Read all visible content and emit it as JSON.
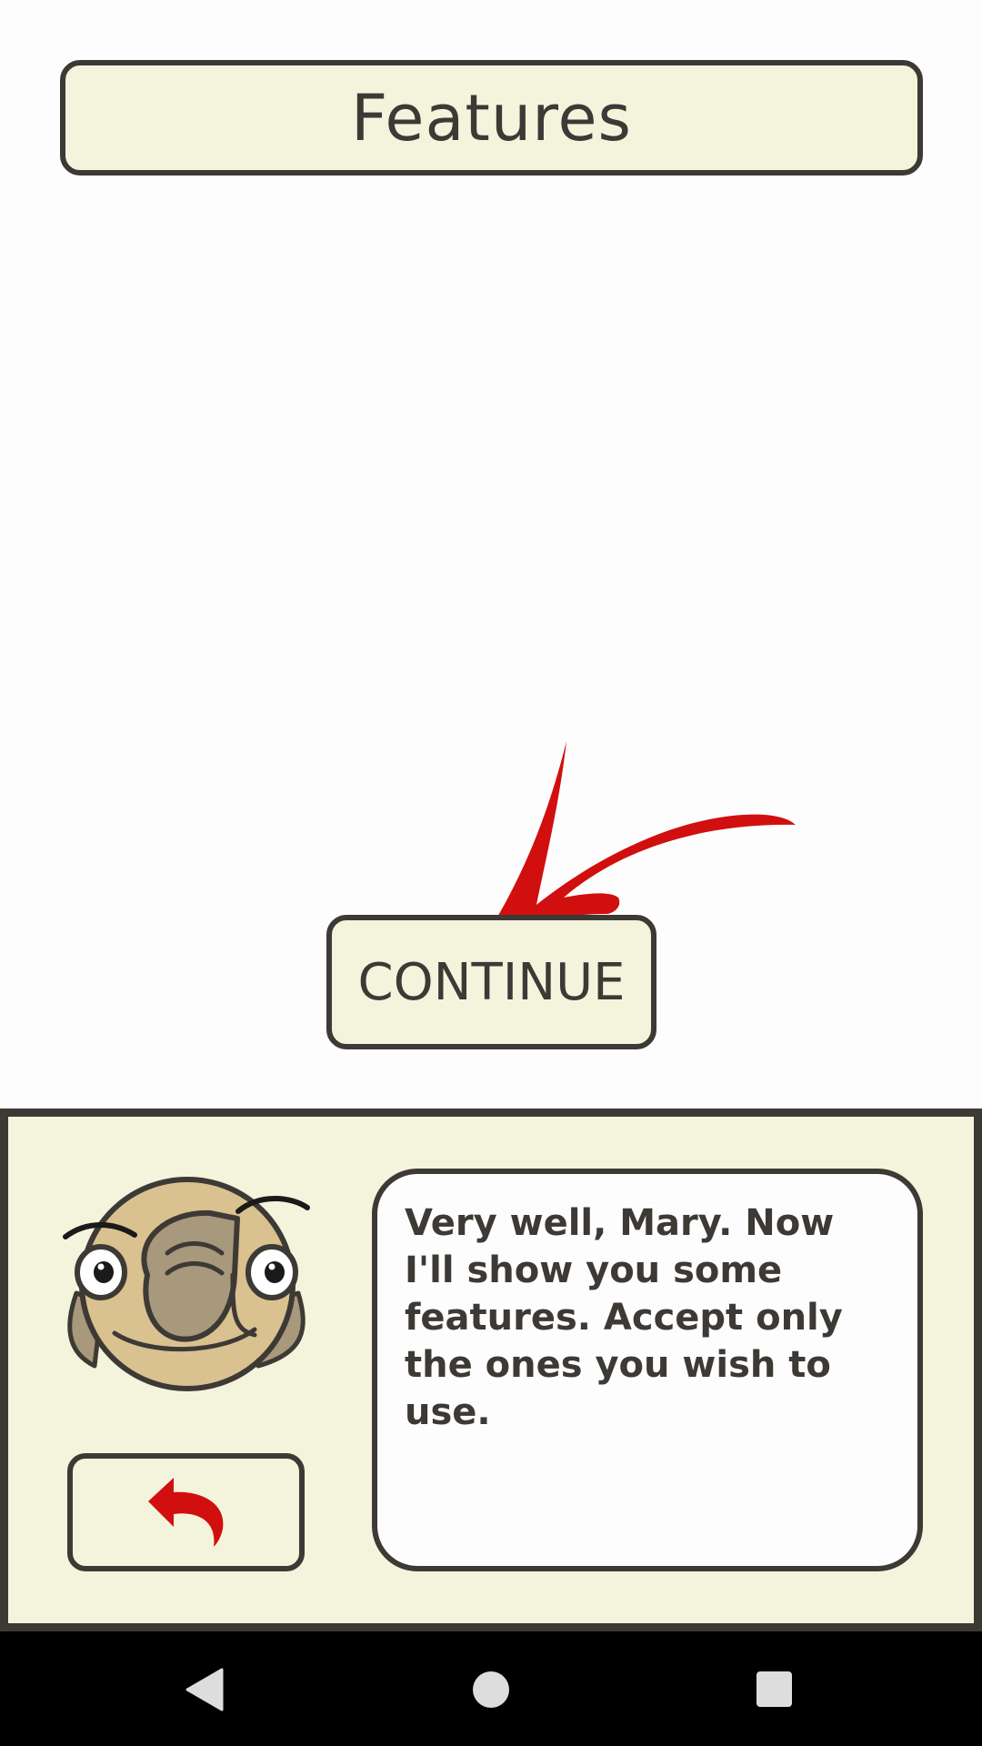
{
  "header": {
    "title": "Features"
  },
  "main": {
    "continue_label": "CONTINUE"
  },
  "dialog": {
    "message": "Very well, Mary. Now I'll show you some features. Accept only the ones you wish to use."
  },
  "icons": {
    "arrow": "red-pointer-arrow-icon",
    "avatar": "owl-face-avatar",
    "back": "undo-arrow-icon",
    "nav_back": "triangle-back-icon",
    "nav_home": "circle-home-icon",
    "nav_recents": "square-recents-icon"
  },
  "colors": {
    "panel_background": "#f4f4dd",
    "border": "#3d3935",
    "accent_red": "#d10f0f",
    "nav_bar": "#000000"
  }
}
